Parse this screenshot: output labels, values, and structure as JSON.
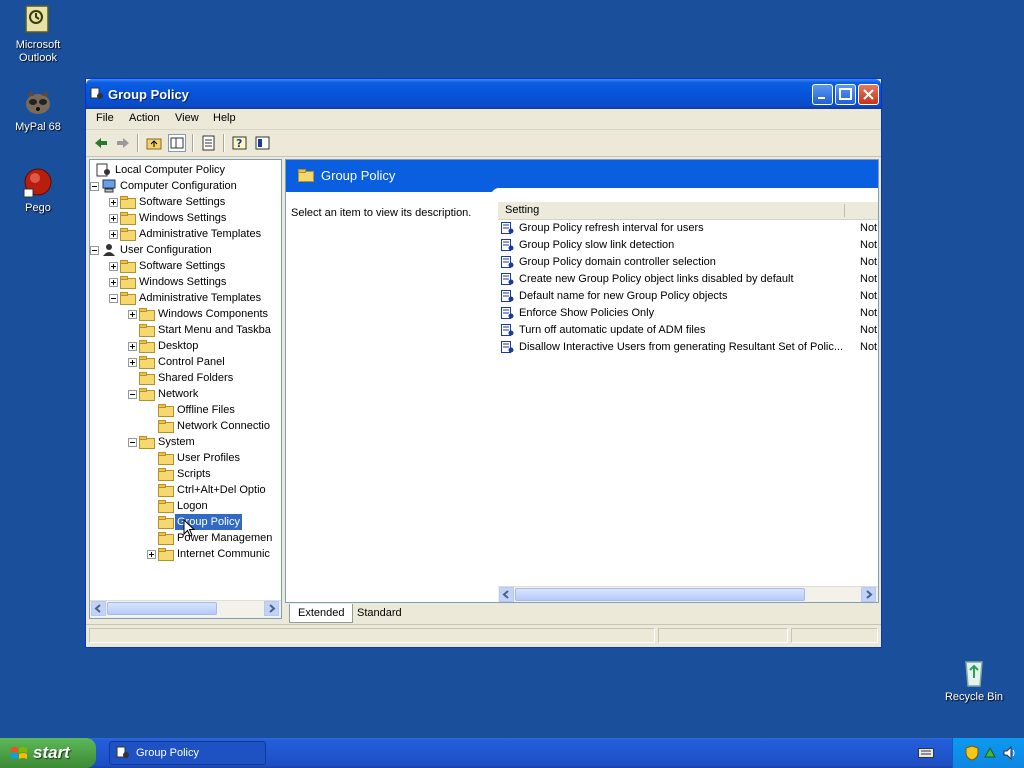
{
  "desktop": {
    "icons": [
      {
        "label_line1": "Microsoft",
        "label_line2": "Outlook",
        "icon": "outlook-icon"
      },
      {
        "label_line1": "MyPal 68",
        "label_line2": "",
        "icon": "mypal-icon"
      },
      {
        "label_line1": "Pego",
        "label_line2": "",
        "icon": "pego-icon"
      },
      {
        "label_line1": "Recycle Bin",
        "label_line2": "",
        "icon": "recycle-bin-icon"
      }
    ]
  },
  "window": {
    "title": "Group Policy",
    "menu": [
      "File",
      "Action",
      "View",
      "Help"
    ],
    "tree": [
      {
        "label": "Local Computer Policy",
        "level": 0,
        "expander": "none",
        "icon": "computer-policy-icon"
      },
      {
        "label": "Computer Configuration",
        "level": 1,
        "expander": "minus",
        "icon": "computer-icon"
      },
      {
        "label": "Software Settings",
        "level": 2,
        "expander": "plus",
        "icon": "folder-icon"
      },
      {
        "label": "Windows Settings",
        "level": 2,
        "expander": "plus",
        "icon": "folder-icon"
      },
      {
        "label": "Administrative Templates",
        "level": 2,
        "expander": "plus",
        "icon": "folder-icon"
      },
      {
        "label": "User Configuration",
        "level": 1,
        "expander": "minus",
        "icon": "user-icon"
      },
      {
        "label": "Software Settings",
        "level": 2,
        "expander": "plus",
        "icon": "folder-icon"
      },
      {
        "label": "Windows Settings",
        "level": 2,
        "expander": "plus",
        "icon": "folder-icon"
      },
      {
        "label": "Administrative Templates",
        "level": 2,
        "expander": "minus",
        "icon": "folder-icon"
      },
      {
        "label": "Windows Components",
        "level": 3,
        "expander": "plus",
        "icon": "folder-icon"
      },
      {
        "label": "Start Menu and Taskba",
        "level": 3,
        "expander": "none",
        "icon": "folder-icon"
      },
      {
        "label": "Desktop",
        "level": 3,
        "expander": "plus",
        "icon": "folder-icon"
      },
      {
        "label": "Control Panel",
        "level": 3,
        "expander": "plus",
        "icon": "folder-icon"
      },
      {
        "label": "Shared Folders",
        "level": 3,
        "expander": "none",
        "icon": "folder-icon"
      },
      {
        "label": "Network",
        "level": 3,
        "expander": "minus",
        "icon": "folder-icon"
      },
      {
        "label": "Offline Files",
        "level": 4,
        "expander": "none",
        "icon": "folder-icon"
      },
      {
        "label": "Network Connectio",
        "level": 4,
        "expander": "none",
        "icon": "folder-icon"
      },
      {
        "label": "System",
        "level": 3,
        "expander": "minus",
        "icon": "folder-icon"
      },
      {
        "label": "User Profiles",
        "level": 4,
        "expander": "none",
        "icon": "folder-icon"
      },
      {
        "label": "Scripts",
        "level": 4,
        "expander": "none",
        "icon": "folder-icon"
      },
      {
        "label": "Ctrl+Alt+Del Optio",
        "level": 4,
        "expander": "none",
        "icon": "folder-icon"
      },
      {
        "label": "Logon",
        "level": 4,
        "expander": "none",
        "icon": "folder-icon"
      },
      {
        "label": "Group Policy",
        "level": 4,
        "expander": "none",
        "icon": "folder-icon",
        "selected": true
      },
      {
        "label": "Power Managemen",
        "level": 4,
        "expander": "none",
        "icon": "folder-icon"
      },
      {
        "label": "Internet Communic",
        "level": 4,
        "expander": "plus",
        "icon": "folder-icon"
      }
    ],
    "right_pane": {
      "header_title": "Group Policy",
      "description": "Select an item to view its description.",
      "column_setting": "Setting",
      "rows": [
        {
          "name": "Group Policy refresh interval for users",
          "state": "Not"
        },
        {
          "name": "Group Policy slow link detection",
          "state": "Not"
        },
        {
          "name": "Group Policy domain controller selection",
          "state": "Not"
        },
        {
          "name": "Create new Group Policy object links disabled by default",
          "state": "Not"
        },
        {
          "name": "Default name for new Group Policy objects",
          "state": "Not"
        },
        {
          "name": "Enforce Show Policies Only",
          "state": "Not"
        },
        {
          "name": "Turn off automatic update of ADM files",
          "state": "Not"
        },
        {
          "name": "Disallow Interactive Users from generating Resultant Set of Polic...",
          "state": "Not"
        }
      ]
    },
    "tabs": [
      "Extended",
      "Standard"
    ]
  },
  "taskbar": {
    "start_label": "start",
    "task_button_label": "Group Policy"
  },
  "colors": {
    "desktop": "#1a4f9c",
    "title_blue": "#0a5ee0",
    "selection": "#316ac5"
  }
}
